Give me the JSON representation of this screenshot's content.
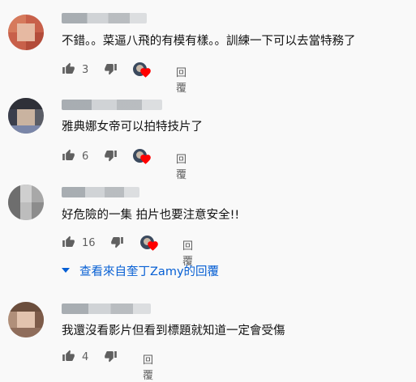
{
  "comments": [
    {
      "text": "不錯。。菜逼八飛的有模有樣。。訓練一下可以去當特務了",
      "likes": "3",
      "reply_label": "回覆",
      "hearted": true
    },
    {
      "text": "雅典娜女帝可以拍特技片了",
      "likes": "6",
      "reply_label": "回覆",
      "hearted": true
    },
    {
      "text": "好危險的一集 拍片也要注意安全!!",
      "likes": "16",
      "reply_label": "回覆",
      "hearted": true
    },
    {
      "text": "我還沒看影片但看到標題就知道一定會受傷",
      "likes": "4",
      "reply_label": "回覆",
      "hearted": false
    }
  ],
  "view_replies_label": "查看來自奎丁Zamy的回覆",
  "icons": [
    "like-icon",
    "dislike-icon",
    "heart-icon",
    "chevron-down-icon"
  ],
  "colors": {
    "link": "#065fd4",
    "heart": "#ff0000",
    "meta": "#606060"
  }
}
